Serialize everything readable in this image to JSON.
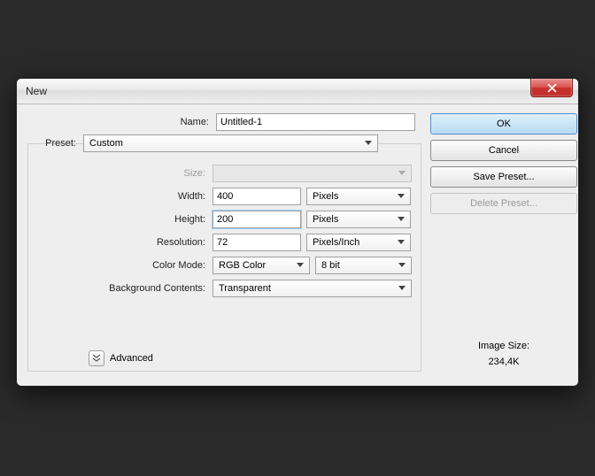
{
  "window": {
    "title": "New"
  },
  "fields": {
    "name_label": "Name:",
    "name_value": "Untitled-1",
    "preset_label": "Preset:",
    "preset_value": "Custom",
    "size_label": "Size:",
    "size_value": "",
    "width_label": "Width:",
    "width_value": "400",
    "width_unit": "Pixels",
    "height_label": "Height:",
    "height_value": "200",
    "height_unit": "Pixels",
    "resolution_label": "Resolution:",
    "resolution_value": "72",
    "resolution_unit": "Pixels/Inch",
    "color_mode_label": "Color Mode:",
    "color_mode_value": "RGB Color",
    "color_depth_value": "8 bit",
    "bg_label": "Background Contents:",
    "bg_value": "Transparent",
    "advanced_label": "Advanced"
  },
  "buttons": {
    "ok": "OK",
    "cancel": "Cancel",
    "save_preset": "Save Preset...",
    "delete_preset": "Delete Preset..."
  },
  "image_size": {
    "label": "Image Size:",
    "value": "234,4K"
  }
}
